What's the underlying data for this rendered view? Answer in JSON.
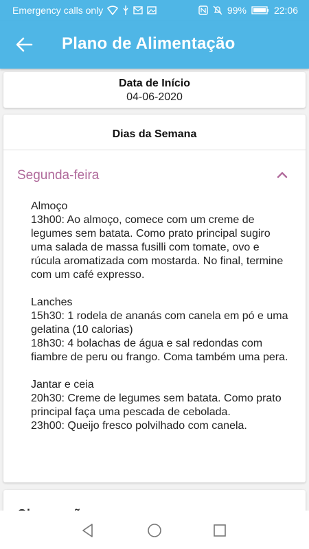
{
  "status_bar": {
    "carrier": "Emergency calls only",
    "battery": "99%",
    "time": "22:06",
    "icons": [
      "wifi-icon",
      "usb-icon",
      "mail-icon",
      "image-icon",
      "nfc-icon",
      "mute-icon",
      "battery-icon"
    ]
  },
  "app_bar": {
    "title": "Plano de Alimentação",
    "back_icon": "back-arrow-icon"
  },
  "start_date": {
    "label": "Data de Início",
    "value": "04-06-2020"
  },
  "week": {
    "header": "Dias da Semana",
    "day": {
      "label": "Segunda-feira",
      "expanded": true,
      "lines": [
        "Almoço",
        "13h00: Ao almoço, comece com um creme de legumes sem batata. Como prato principal sugiro uma salada de massa fusilli com tomate, ovo e rúcula aromatizada com mostarda. No final, termine com um café expresso.",
        "",
        "Lanches",
        "15h30: 1 rodela de ananás com canela em pó e uma gelatina (10 calorias)",
        "18h30: 4 bolachas de água e sal redondas com fiambre de peru ou frango. Coma também uma pera.",
        "",
        "Jantar e ceia",
        "20h30: Creme de legumes sem batata. Como prato principal faça uma pescada de cebolada.",
        "23h00: Queijo fresco polvilhado com canela."
      ]
    }
  },
  "observations": {
    "label": "Observações"
  },
  "colors": {
    "primary": "#4fb6e6",
    "accent": "#b06a9b"
  }
}
